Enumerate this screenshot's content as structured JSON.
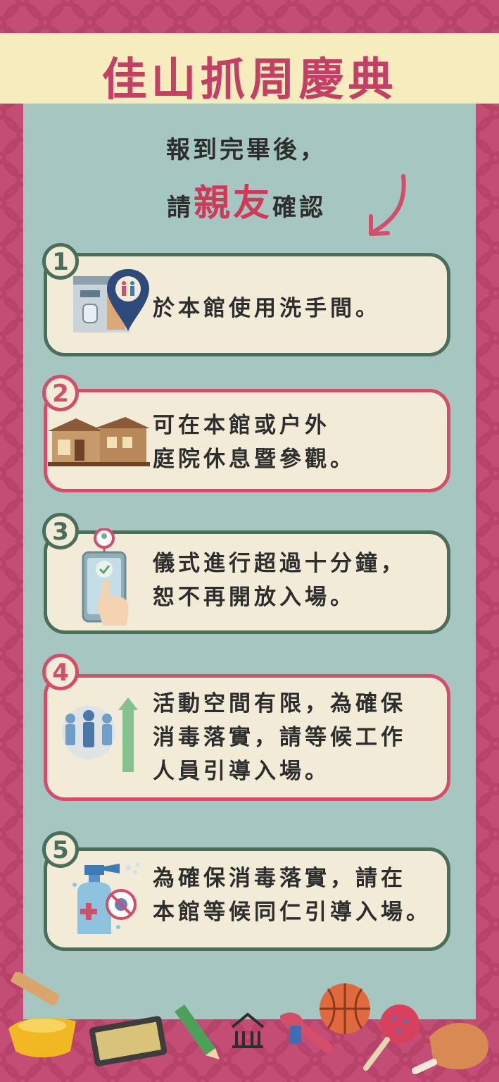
{
  "title": "佳山抓周慶典",
  "intro": {
    "line1": "報到完畢後，",
    "line2_prefix": "請",
    "line2_accent": "親友",
    "line2_suffix": "確認"
  },
  "steps": [
    {
      "number": "1",
      "text_lines": [
        "於本館使用洗手間。"
      ],
      "icon": "restroom-location-icon"
    },
    {
      "number": "2",
      "text_lines": [
        "可在本館或户外",
        "庭院休息暨參觀。"
      ],
      "icon": "building-icon"
    },
    {
      "number": "3",
      "text_lines": [
        "儀式進行超過十分鐘，",
        "恕不再開放入場。"
      ],
      "icon": "phone-checkin-icon"
    },
    {
      "number": "4",
      "text_lines": [
        "活動空間有限，為確保",
        "消毒落實，請等候工作",
        "人員引導入場。"
      ],
      "icon": "group-arrow-icon"
    },
    {
      "number": "5",
      "text_lines": [
        "為確保消毒落實，請在",
        "本館等候同仁引導入場。"
      ],
      "icon": "sanitizer-icon"
    }
  ],
  "colors": {
    "background": "#c44d75",
    "panel": "#a6c6c1",
    "card": "#f2ebd7",
    "green": "#4a6e5a",
    "red": "#d34e68",
    "title": "#c43f66"
  }
}
